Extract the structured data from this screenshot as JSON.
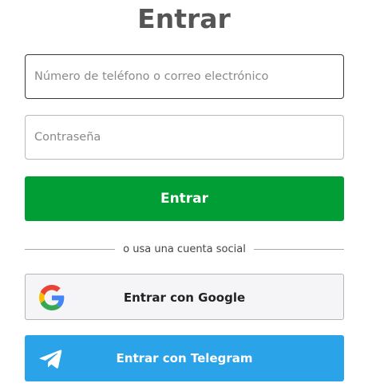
{
  "title": "Entrar",
  "form": {
    "phone_placeholder": "Número de teléfono o correo electrónico",
    "phone_value": "",
    "password_placeholder": "Contraseña",
    "password_value": "",
    "submit_label": "Entrar"
  },
  "divider_text": "o usa una cuenta social",
  "social": {
    "google_label": "Entrar con Google",
    "google_icon": "google-icon",
    "telegram_label": "Entrar con Telegram",
    "telegram_icon": "telegram-icon"
  },
  "colors": {
    "submit": "#009e34",
    "telegram": "#2aa3e8",
    "google_bg": "#f5f5f7"
  }
}
